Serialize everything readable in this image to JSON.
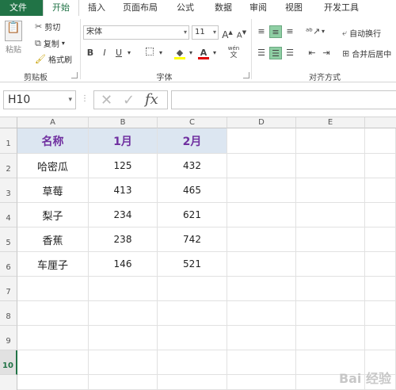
{
  "tabs": [
    "文件",
    "开始",
    "插入",
    "页面布局",
    "公式",
    "数据",
    "审阅",
    "视图",
    "开发工具"
  ],
  "clipboard": {
    "paste": "粘贴",
    "cut": "剪切",
    "copy": "复制",
    "format_painter": "格式刷",
    "group": "剪贴板"
  },
  "font": {
    "name": "宋体",
    "size": "11",
    "grow": "A",
    "shrink": "A",
    "bold": "B",
    "italic": "I",
    "underline": "U",
    "phonetic": "wén",
    "group": "字体"
  },
  "alignment": {
    "wrap": "自动换行",
    "merge": "合并后居中",
    "group": "对齐方式"
  },
  "namebox": "H10",
  "fx": "fx",
  "columns": [
    "A",
    "B",
    "C",
    "D",
    "E"
  ],
  "rows": [
    "1",
    "2",
    "3",
    "4",
    "5",
    "6",
    "7",
    "8",
    "9",
    "10"
  ],
  "table": {
    "headers": [
      "名称",
      "1月",
      "2月"
    ],
    "rows": [
      [
        "哈密瓜",
        "125",
        "432"
      ],
      [
        "草莓",
        "413",
        "465"
      ],
      [
        "梨子",
        "234",
        "621"
      ],
      [
        "香蕉",
        "238",
        "742"
      ],
      [
        "车厘子",
        "146",
        "521"
      ]
    ]
  },
  "watermark": "Bai 经验",
  "colors": {
    "accent": "#217346",
    "header_fill": "#dce6f1",
    "header_text": "#7030a0"
  }
}
